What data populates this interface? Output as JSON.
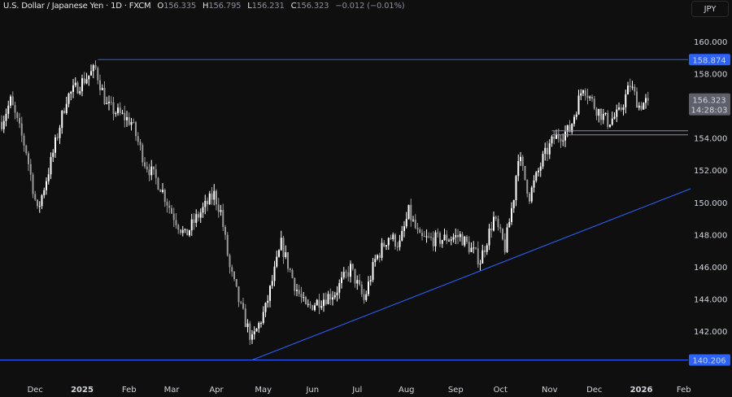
{
  "header": {
    "symbol": "U.S. Dollar / Japanese Yen · 1D · FXCM",
    "open_label": "O",
    "open": "156.335",
    "high_label": "H",
    "high": "156.795",
    "low_label": "L",
    "low": "156.231",
    "close_label": "C",
    "close": "156.323",
    "change": "−0.012 (−0.01%)"
  },
  "currency_button": "JPY",
  "colors": {
    "background": "#0f0f0f",
    "level_line": "#2962ff",
    "support_zone": "#8a8e99",
    "up": "#ffffff",
    "down": "#9a9a9a",
    "current_label": "#5d606b"
  },
  "chart_data": {
    "type": "candlestick",
    "title": "U.S. Dollar / Japanese Yen · 1D · FXCM",
    "ylim": [
      139.6,
      161.2
    ],
    "y_ticks": [
      "160.000",
      "158.000",
      "156.000",
      "154.000",
      "152.000",
      "150.000",
      "148.000",
      "146.000",
      "144.000",
      "142.000"
    ],
    "y_tick_values": [
      160,
      158,
      156,
      154,
      152,
      150,
      148,
      146,
      144,
      142
    ],
    "x_ticks": [
      "Dec",
      "2025",
      "Feb",
      "Mar",
      "Apr",
      "May",
      "Jun",
      "Jul",
      "Aug",
      "Sep",
      "Oct",
      "Nov",
      "Dec",
      "2026",
      "Feb"
    ],
    "x_tick_days": [
      15,
      36,
      57,
      76,
      96,
      117,
      139,
      159,
      181,
      203,
      223,
      245,
      265,
      286,
      305
    ],
    "close_path_day_price": [
      [
        0,
        155.0
      ],
      [
        4,
        156.3
      ],
      [
        11,
        153.2
      ],
      [
        16,
        149.4
      ],
      [
        22,
        152.5
      ],
      [
        29,
        156.5
      ],
      [
        36,
        157.5
      ],
      [
        42,
        158.3
      ],
      [
        47,
        156.0
      ],
      [
        58,
        155.0
      ],
      [
        64,
        152.5
      ],
      [
        71,
        151.0
      ],
      [
        76,
        149.4
      ],
      [
        82,
        147.9
      ],
      [
        87,
        149.0
      ],
      [
        95,
        150.5
      ],
      [
        98,
        149.4
      ],
      [
        102,
        145.9
      ],
      [
        107,
        143.4
      ],
      [
        112,
        141.4
      ],
      [
        118,
        143.4
      ],
      [
        125,
        147.4
      ],
      [
        131,
        144.9
      ],
      [
        136,
        143.4
      ],
      [
        142,
        143.9
      ],
      [
        149,
        144.4
      ],
      [
        156,
        145.9
      ],
      [
        162,
        143.9
      ],
      [
        167,
        146.4
      ],
      [
        173,
        147.9
      ],
      [
        178,
        147.4
      ],
      [
        182,
        149.4
      ],
      [
        187,
        147.7
      ],
      [
        196,
        147.7
      ],
      [
        205,
        147.9
      ],
      [
        214,
        146.4
      ],
      [
        220,
        149.0
      ],
      [
        225,
        147.2
      ],
      [
        229,
        150.4
      ],
      [
        231,
        153.0
      ],
      [
        236,
        150.4
      ],
      [
        242,
        152.7
      ],
      [
        247,
        154.0
      ],
      [
        254,
        154.5
      ],
      [
        260,
        157.3
      ],
      [
        265,
        156.0
      ],
      [
        271,
        155.0
      ],
      [
        276,
        155.5
      ],
      [
        281,
        157.3
      ],
      [
        285,
        156.0
      ],
      [
        289,
        156.323
      ]
    ],
    "levels": {
      "resistance": {
        "label": "158.874",
        "value": 158.874,
        "from_day": 43
      },
      "support": {
        "label": "140.206",
        "value": 140.206,
        "from_day": 0
      },
      "zone": {
        "values": [
          154.45,
          154.2
        ],
        "from_day": 246
      },
      "trendline": {
        "from": [
          112,
          140.206
        ],
        "to": [
          308,
          150.85
        ]
      }
    },
    "last_price_label": "156.323",
    "countdown": "14:28:03"
  }
}
